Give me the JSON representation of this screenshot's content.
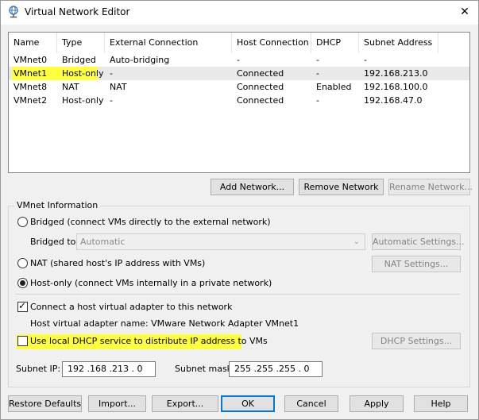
{
  "window": {
    "title": "Virtual Network Editor",
    "close_glyph": "✕"
  },
  "network_table": {
    "columns": [
      "Name",
      "Type",
      "External Connection",
      "Host Connection",
      "DHCP",
      "Subnet Address"
    ],
    "rows": [
      [
        "VMnet0",
        "Bridged",
        "Auto-bridging",
        "-",
        "-",
        "-"
      ],
      [
        "VMnet1",
        "Host-only",
        "-",
        "Connected",
        "-",
        "192.168.213.0"
      ],
      [
        "VMnet8",
        "NAT",
        "NAT",
        "Connected",
        "Enabled",
        "192.168.100.0"
      ],
      [
        "VMnet2",
        "Host-only",
        "-",
        "Connected",
        "-",
        "192.168.47.0"
      ]
    ],
    "selected_row": "VMnet1"
  },
  "table_buttons": {
    "add": "Add Network...",
    "remove": "Remove Network",
    "rename": "Rename Network..."
  },
  "vmnet_info": {
    "group_label": "VMnet Information",
    "bridged_label": "Bridged (connect VMs directly to the external network)",
    "bridged_to_label": "Bridged to:",
    "bridged_to_value": "Automatic",
    "automatic_settings": "Automatic Settings...",
    "nat_label": "NAT (shared host's IP address with VMs)",
    "nat_settings": "NAT Settings...",
    "hostonly_label": "Host-only (connect VMs internally in a private network)",
    "selected_mode": "Host-only",
    "connect_adapter_label": "Connect a host virtual adapter to this network",
    "connect_adapter_checked": true,
    "adapter_name_label": "Host virtual adapter name: VMware Network Adapter VMnet1",
    "dhcp_label": "Use local DHCP service to distribute IP address to VMs",
    "dhcp_checked": false,
    "dhcp_settings": "DHCP Settings...",
    "subnet_ip_label": "Subnet IP:",
    "subnet_ip_value": "192 .168 .213 . 0",
    "subnet_mask_label": "Subnet mask:",
    "subnet_mask_value": "255 .255 .255 . 0"
  },
  "footer_buttons": {
    "restore": "Restore Defaults",
    "import": "Import...",
    "export": "Export...",
    "ok": "OK",
    "cancel": "Cancel",
    "apply": "Apply",
    "help": "Help"
  },
  "colors": {
    "highlight": "#ffff3c",
    "focus_border": "#0078d7"
  }
}
